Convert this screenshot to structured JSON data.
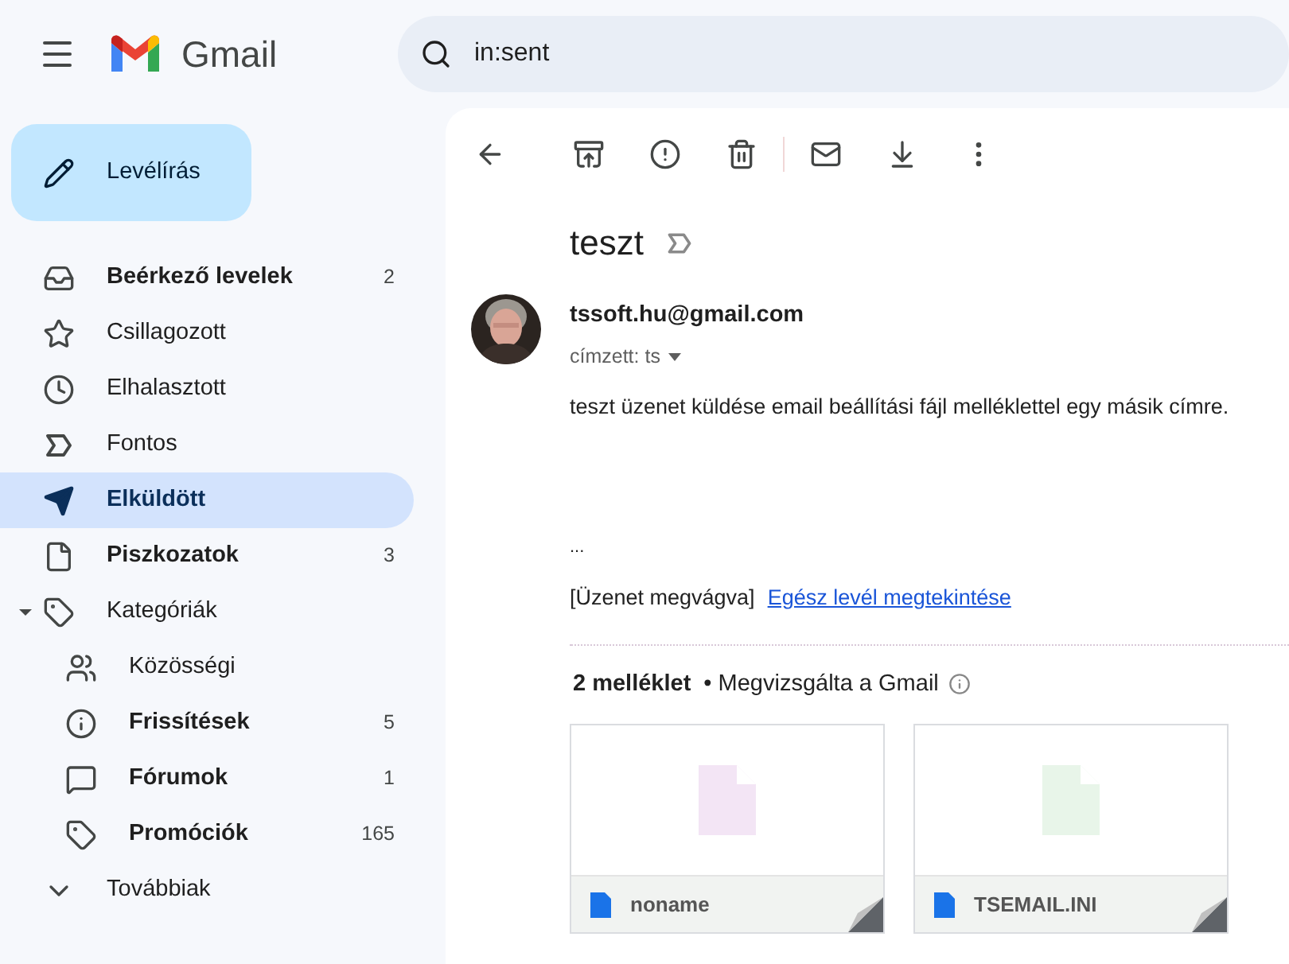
{
  "app": {
    "name": "Gmail"
  },
  "search": {
    "value": "in:sent"
  },
  "compose": {
    "label": "Levélírás"
  },
  "nav": [
    {
      "kind": "inbox",
      "label": "Beérkező levelek",
      "count": "2",
      "unread": true,
      "selected": false
    },
    {
      "kind": "star",
      "label": "Csillagozott",
      "unread": false,
      "selected": false
    },
    {
      "kind": "clock",
      "label": "Elhalasztott",
      "unread": false,
      "selected": false
    },
    {
      "kind": "important",
      "label": "Fontos",
      "unread": false,
      "selected": false
    },
    {
      "kind": "send",
      "label": "Elküldött",
      "unread": true,
      "selected": true
    },
    {
      "kind": "file",
      "label": "Piszkozatok",
      "count": "3",
      "unread": true,
      "selected": false
    },
    {
      "kind": "label",
      "label": "Kategóriák",
      "unread": false,
      "selected": false,
      "expanded": true,
      "children": [
        {
          "kind": "people",
          "label": "Közösségi",
          "unread": false,
          "selected": false
        },
        {
          "kind": "info",
          "label": "Frissítések",
          "count": "5",
          "unread": true,
          "selected": false
        },
        {
          "kind": "forum",
          "label": "Fórumok",
          "count": "1",
          "unread": true,
          "selected": false
        },
        {
          "kind": "tag",
          "label": "Promóciók",
          "count": "165",
          "unread": true,
          "selected": false
        }
      ]
    },
    {
      "kind": "more",
      "label": "Továbbiak",
      "unread": false,
      "selected": false
    }
  ],
  "message": {
    "subject": "teszt",
    "sender": "tssoft.hu@gmail.com",
    "recipient": "címzett: ts",
    "body": "teszt üzenet küldése email beállítási fájl melléklettel egy másik címre.",
    "ellipsis": "...",
    "clipped_note": "[Üzenet megvágva]",
    "view_full_link": "Egész levél megtekintése"
  },
  "attachments": {
    "count_label": "2 melléklet",
    "scan_note": "• Megvizsgálta a Gmail",
    "files": [
      {
        "name": "noname",
        "color": "#f3e5f5"
      },
      {
        "name": "TSEMAIL.INI",
        "color": "#e8f5e9"
      }
    ]
  }
}
